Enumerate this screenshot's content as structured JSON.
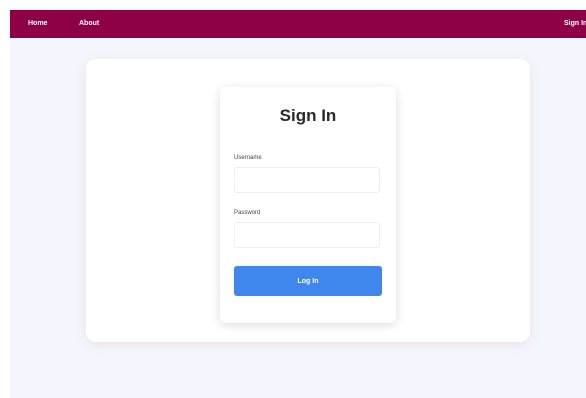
{
  "navbar": {
    "home_label": "Home",
    "about_label": "About",
    "signin_label": "Sign In"
  },
  "login_form": {
    "title": "Sign In",
    "username_label": "Username",
    "username_value": "",
    "username_placeholder": "",
    "password_label": "Password",
    "password_value": "",
    "password_placeholder": "",
    "submit_label": "Log In"
  },
  "colors": {
    "navbar_background": "#8e0045",
    "page_background": "#f3f6fc",
    "button_background": "#3f87ec",
    "button_text": "#ffffff"
  }
}
